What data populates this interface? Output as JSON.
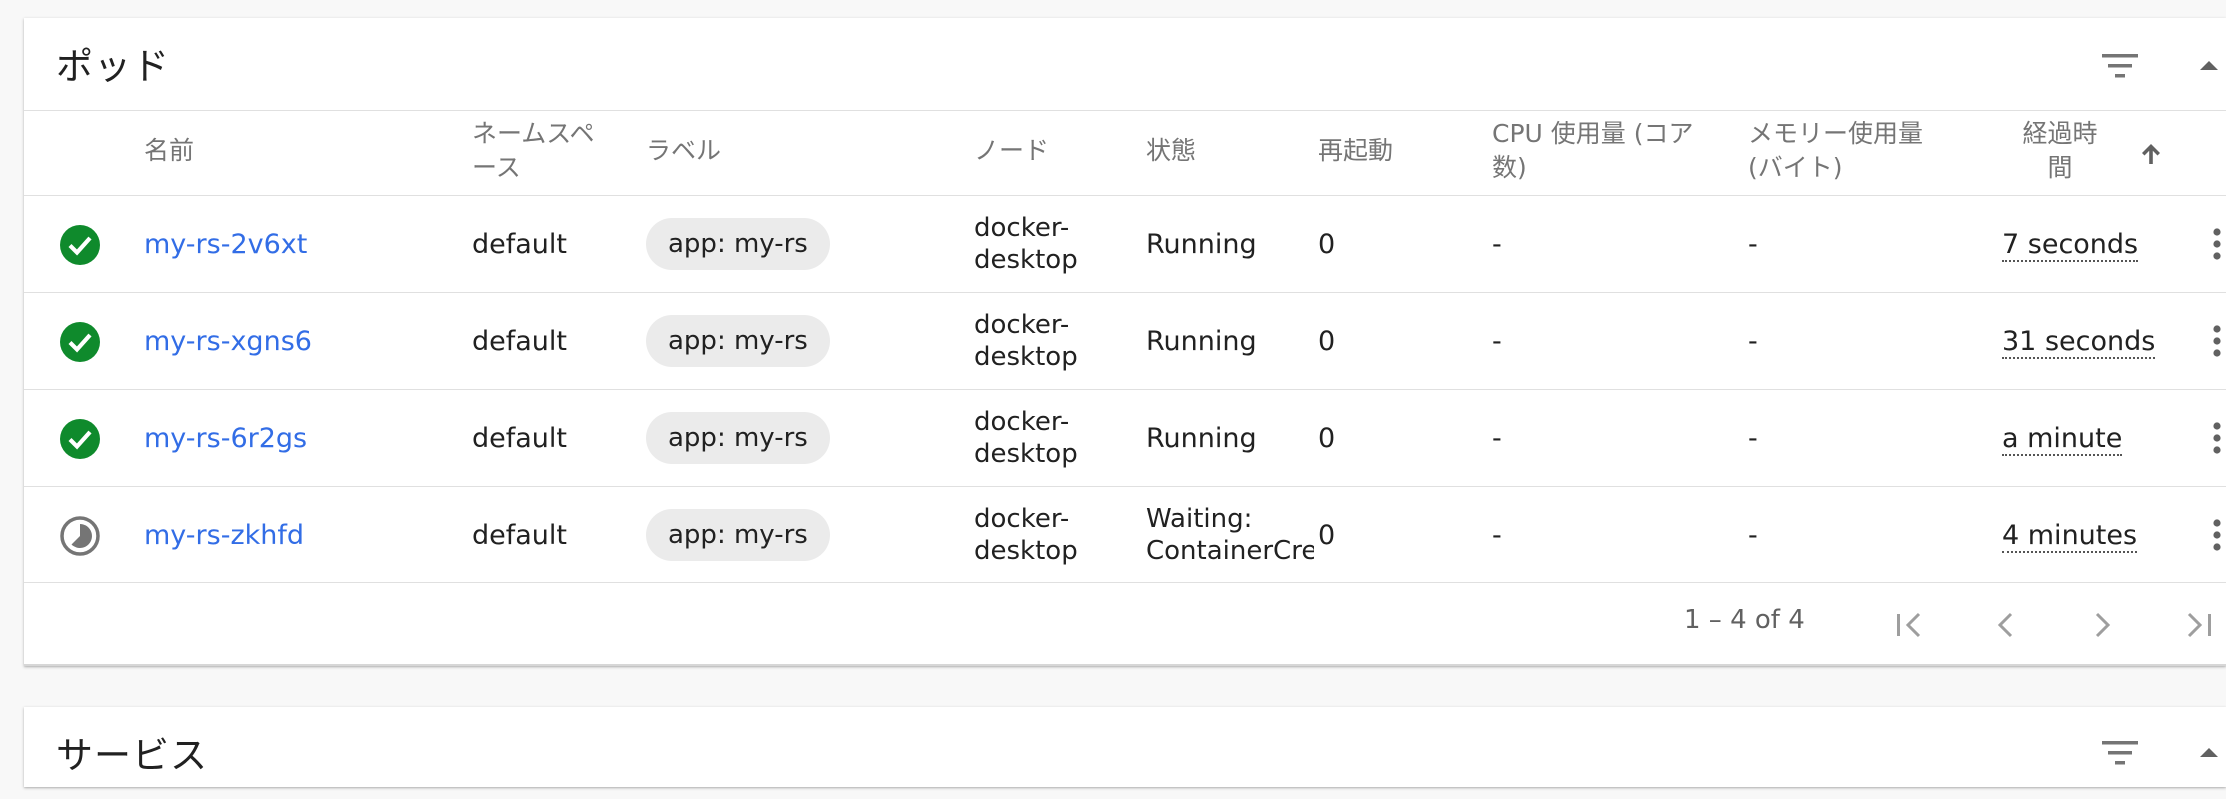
{
  "pods_card": {
    "title": "ポッド",
    "columns": {
      "name": "名前",
      "namespace_l1": "ネームスペ",
      "namespace_l2": "ース",
      "labels": "ラベル",
      "node": "ノード",
      "status": "状態",
      "restarts": "再起動",
      "cpu_l1": "CPU 使用量 (コア",
      "cpu_l2": "数)",
      "memory_l1": "メモリー使用量",
      "memory_l2": "(バイト)",
      "age_l1": "経過時",
      "age_l2": "間"
    },
    "rows": [
      {
        "status_icon": "check-circle-icon",
        "name": "my-rs-2v6xt",
        "namespace": "default",
        "label": "app: my-rs",
        "node_l1": "docker-",
        "node_l2": "desktop",
        "status": "Running",
        "restarts": "0",
        "cpu": "-",
        "memory": "-",
        "age": "7 seconds"
      },
      {
        "status_icon": "check-circle-icon",
        "name": "my-rs-xgns6",
        "namespace": "default",
        "label": "app: my-rs",
        "node_l1": "docker-",
        "node_l2": "desktop",
        "status": "Running",
        "restarts": "0",
        "cpu": "-",
        "memory": "-",
        "age": "31 seconds"
      },
      {
        "status_icon": "check-circle-icon",
        "name": "my-rs-6r2gs",
        "namespace": "default",
        "label": "app: my-rs",
        "node_l1": "docker-",
        "node_l2": "desktop",
        "status": "Running",
        "restarts": "0",
        "cpu": "-",
        "memory": "-",
        "age": "a minute"
      },
      {
        "status_icon": "pending-timelapse-icon",
        "name": "my-rs-zkhfd",
        "namespace": "default",
        "label": "app: my-rs",
        "node_l1": "docker-",
        "node_l2": "desktop",
        "status_l1": "Waiting:",
        "status_l2": "ContainerCreating",
        "restarts": "0",
        "cpu": "-",
        "memory": "-",
        "age": "4 minutes"
      }
    ],
    "pagination": {
      "range": "1 – 4 of 4"
    }
  },
  "services_card": {
    "title": "サービス"
  },
  "colors": {
    "link": "#326de6",
    "success": "#0f8a2c",
    "pending": "#757575",
    "header_text": "#757575"
  }
}
